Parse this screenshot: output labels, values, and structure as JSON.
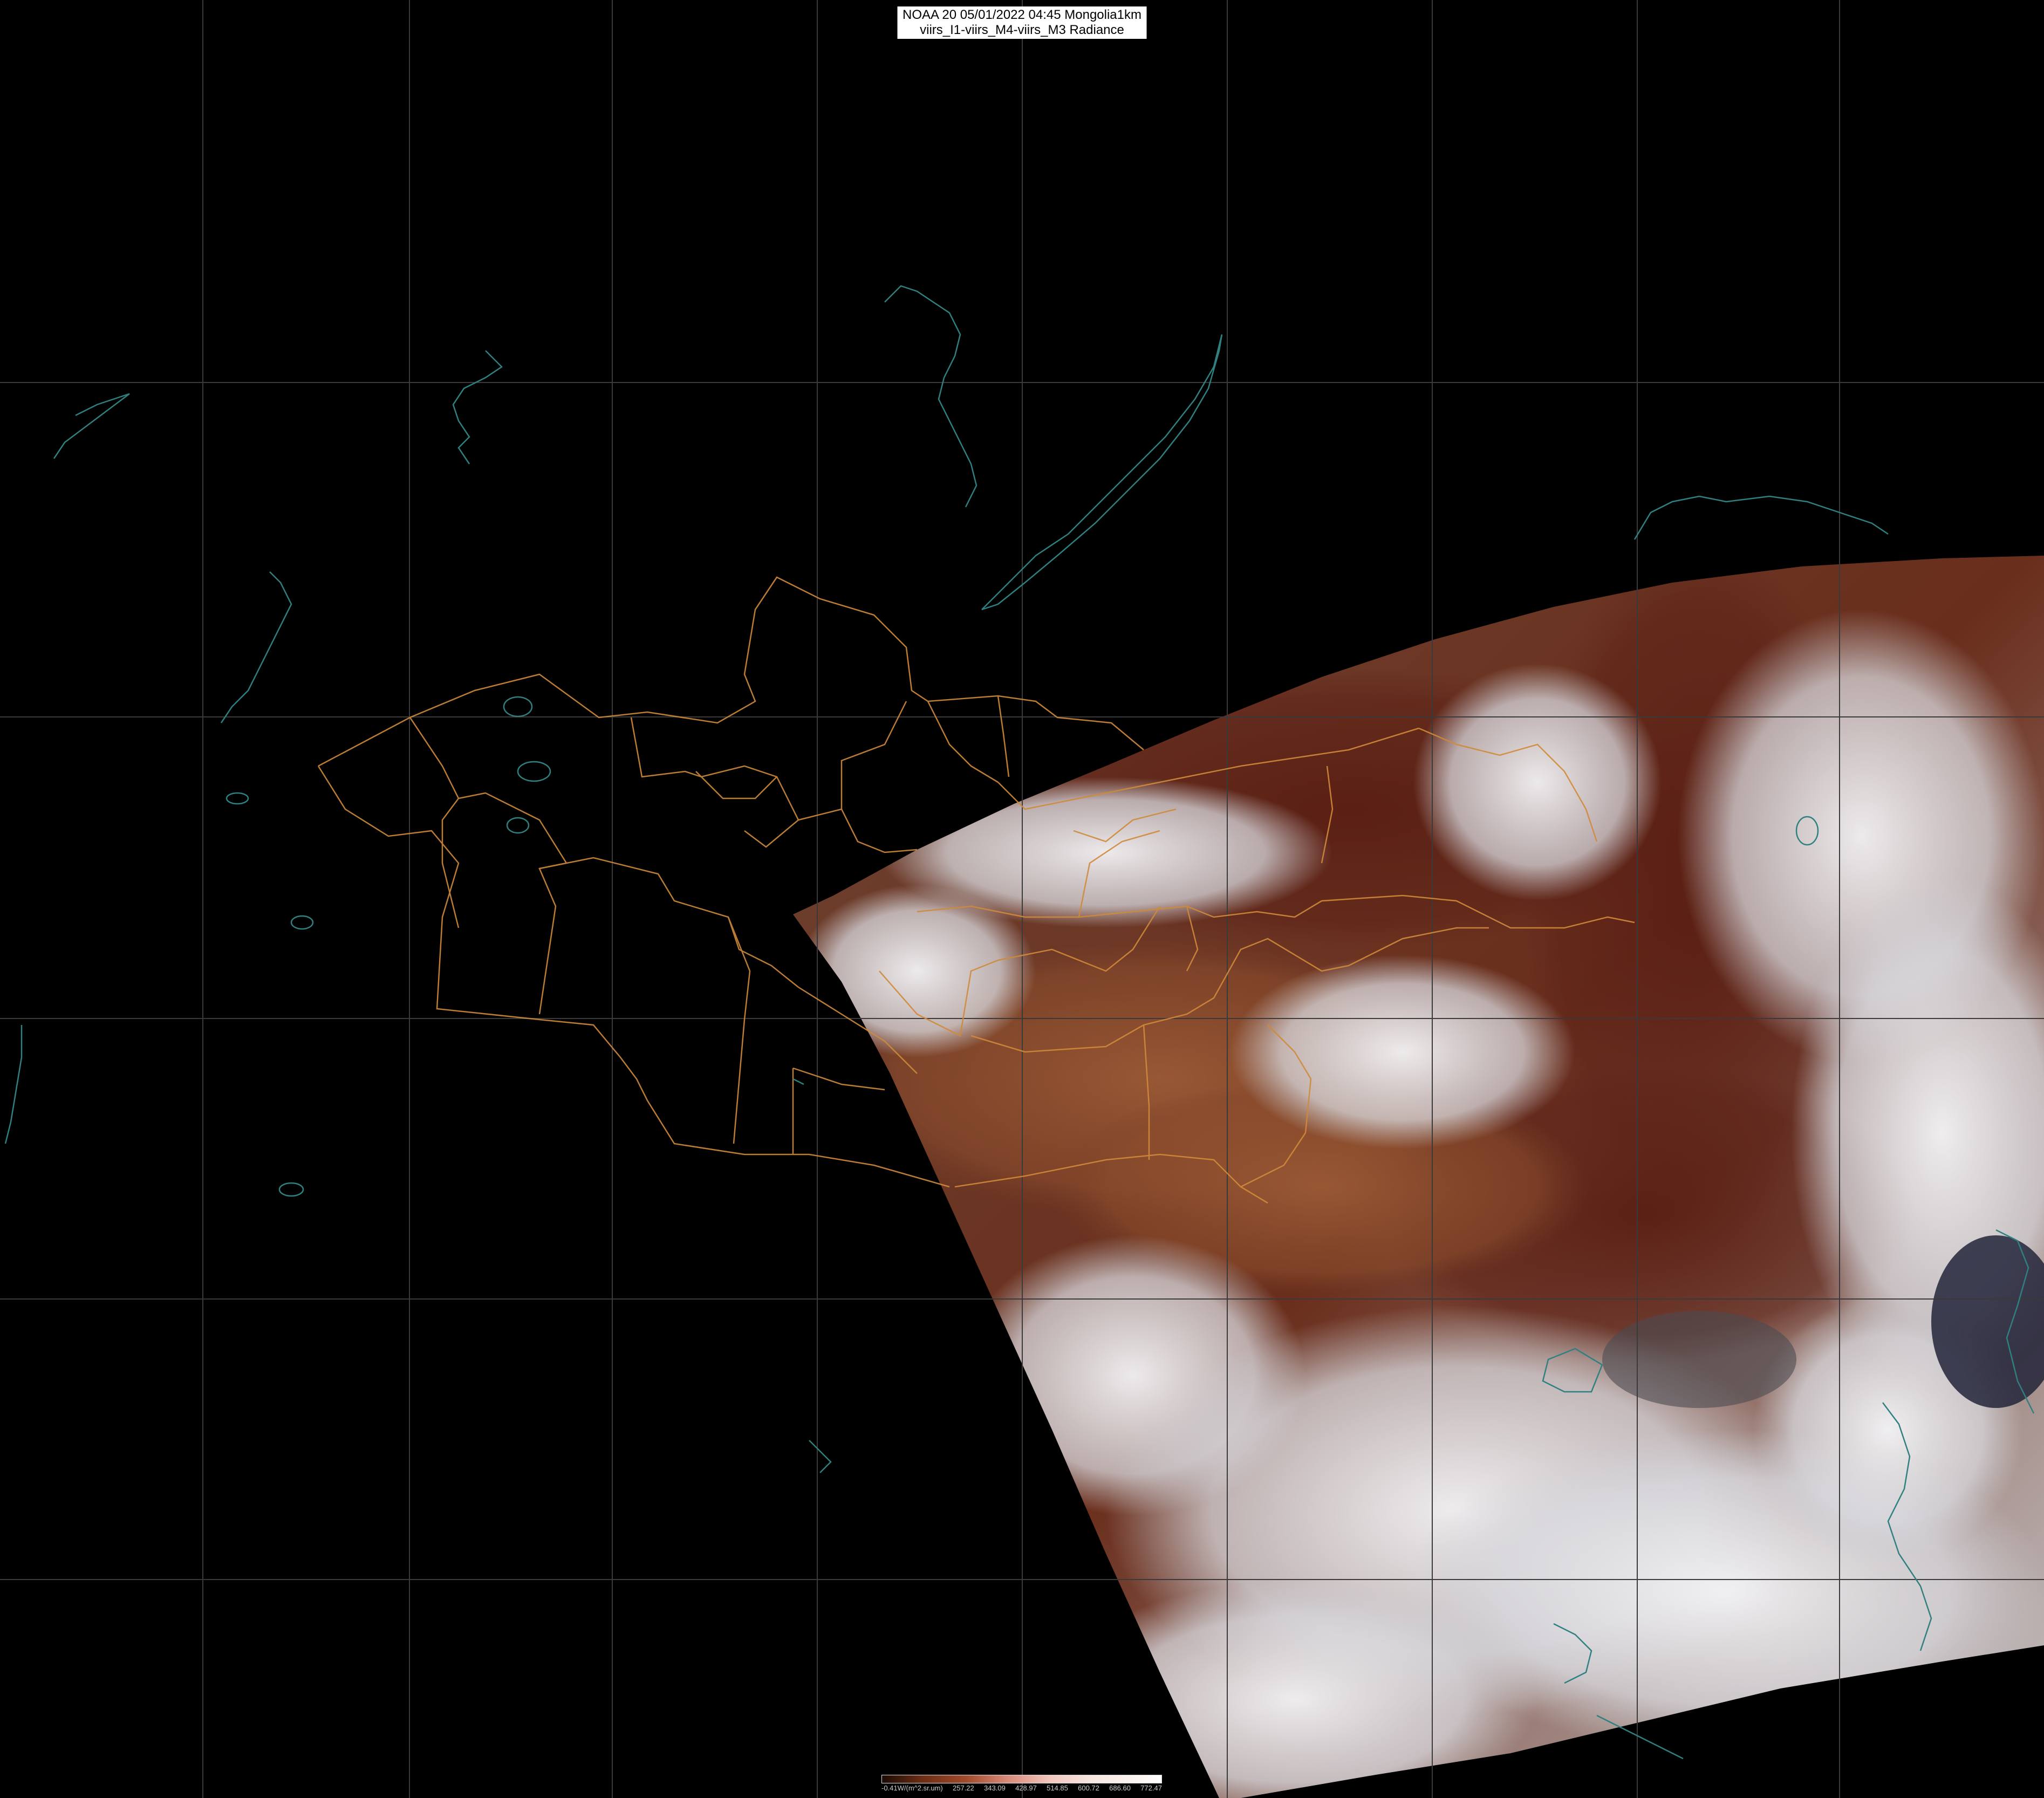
{
  "title": {
    "line1": "NOAA 20 05/01/2022 04:45 Mongolia1km",
    "line2": "viirs_I1-viirs_M4-viirs_M3 Radiance"
  },
  "colorbar": {
    "labels": [
      "-0.41W/(m^2.sr.um)",
      "257.22",
      "343.09",
      "428.97",
      "514.85",
      "600.72",
      "686.60",
      "772.47"
    ],
    "colors": [
      "#1a0a05",
      "#6b2d14",
      "#a14a2b",
      "#d98a7a",
      "#f2c6bd",
      "#f7e6e0",
      "#fbf3ef",
      "#ffffff"
    ]
  },
  "colors": {
    "background": "#000000",
    "grid": "#3a3a3a",
    "borders": "#d08a3a",
    "coast": "#2f8080",
    "title_bg": "#ffffff"
  }
}
